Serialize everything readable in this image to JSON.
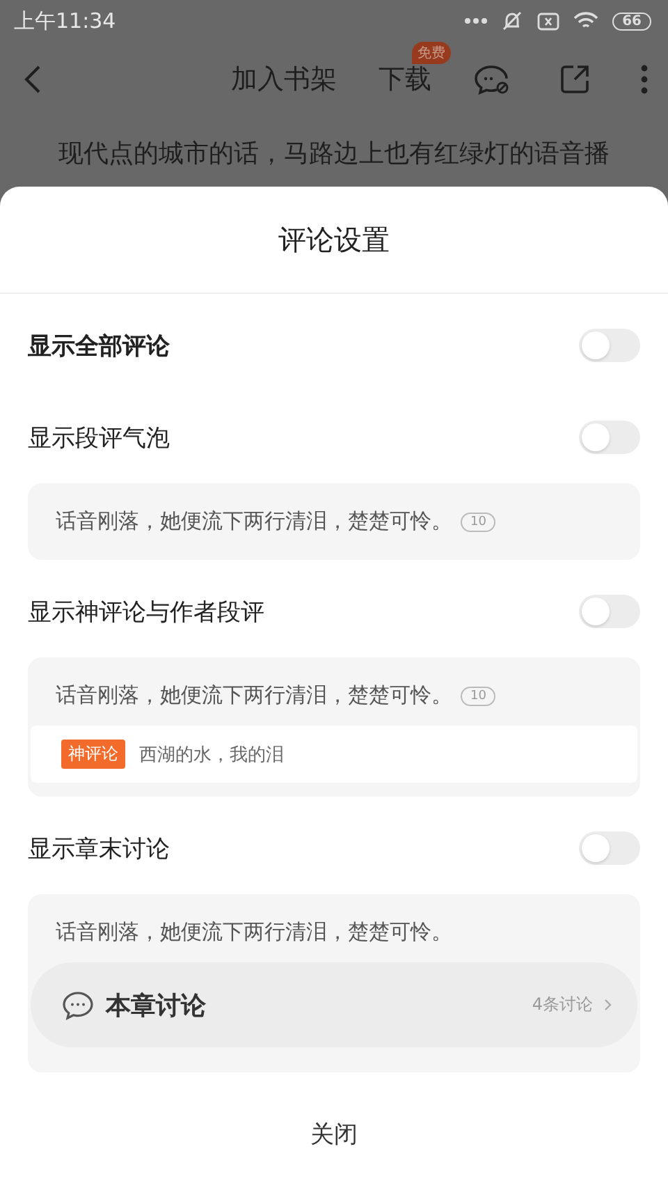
{
  "status_bar": {
    "time": "上午11:34",
    "battery": "66"
  },
  "toolbar": {
    "actions": [
      {
        "label": "加入书架"
      },
      {
        "label": "下载",
        "badge": "免费"
      }
    ]
  },
  "reader_text": "现代点的城市的话，马路边上也有红绿灯的语音播",
  "sheet": {
    "title": "评论设置",
    "settings": [
      {
        "kind": "master",
        "label": "显示全部评论",
        "on": false
      },
      {
        "kind": "option",
        "label": "显示段评气泡",
        "on": false,
        "preview": {
          "kind": "bubble",
          "text": "话音刚落，她便流下两行清泪，楚楚可怜。",
          "count": "10"
        }
      },
      {
        "kind": "option",
        "label": "显示神评论与作者段评",
        "on": false,
        "preview": {
          "kind": "god_comment",
          "text": "话音刚落，她便流下两行清泪，楚楚可怜。",
          "count": "10",
          "tag": "神评论",
          "comment": "西湖的水，我的泪"
        }
      },
      {
        "kind": "option",
        "label": "显示章末讨论",
        "on": false,
        "preview": {
          "kind": "discussion",
          "text": "话音刚落，她便流下两行清泪，楚楚可怜。",
          "title": "本章讨论",
          "count": "4条讨论"
        }
      }
    ],
    "close": "关闭"
  }
}
